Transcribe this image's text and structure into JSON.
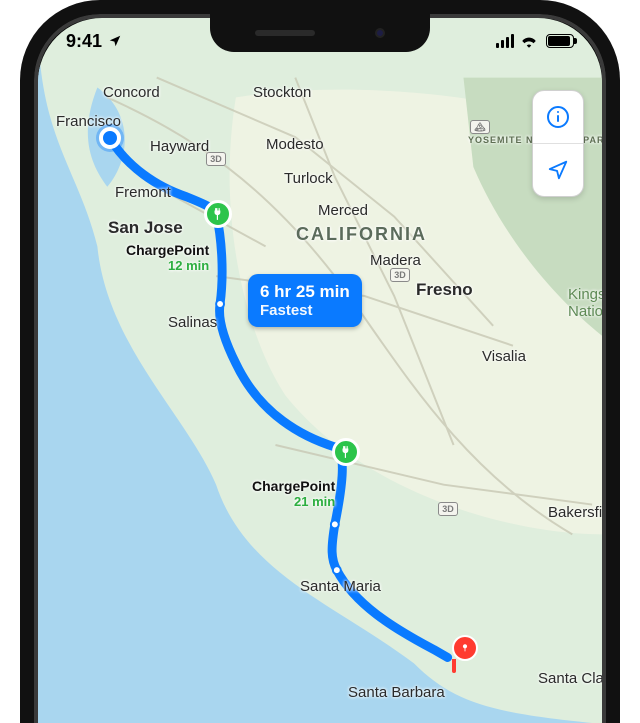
{
  "status_bar": {
    "time": "9:41"
  },
  "region_label": "CALIFORNIA",
  "park_label": "YOSEMITE NATIONAL PARK",
  "cities": {
    "concord": {
      "text": "Concord",
      "t": 66,
      "l": 65,
      "cls": "town"
    },
    "stockton": {
      "text": "Stockton",
      "t": 66,
      "l": 215,
      "cls": "town"
    },
    "sf": {
      "text": "Francisco",
      "t": 95,
      "l": 18,
      "cls": "town"
    },
    "hayward": {
      "text": "Hayward",
      "t": 120,
      "l": 112,
      "cls": "town"
    },
    "modesto": {
      "text": "Modesto",
      "t": 118,
      "l": 228,
      "cls": "town"
    },
    "turlock": {
      "text": "Turlock",
      "t": 152,
      "l": 246,
      "cls": "town"
    },
    "fremont": {
      "text": "Fremont",
      "t": 166,
      "l": 77,
      "cls": "town"
    },
    "merced": {
      "text": "Merced",
      "t": 184,
      "l": 280,
      "cls": "town"
    },
    "sanjose": {
      "text": "San Jose",
      "t": 200,
      "l": 70,
      "cls": "city"
    },
    "madera": {
      "text": "Madera",
      "t": 234,
      "l": 332,
      "cls": "town"
    },
    "fresno": {
      "text": "Fresno",
      "t": 262,
      "l": 378,
      "cls": "city"
    },
    "kings": {
      "text": "Kings\nNation",
      "t": 268,
      "l": 530,
      "cls": "town"
    },
    "salinas": {
      "text": "Salinas",
      "t": 296,
      "l": 130,
      "cls": "town"
    },
    "visalia": {
      "text": "Visalia",
      "t": 330,
      "l": 444,
      "cls": "town"
    },
    "bakersfield": {
      "text": "Bakersfield",
      "t": 486,
      "l": 510,
      "cls": "town"
    },
    "santamaria": {
      "text": "Santa Maria",
      "t": 560,
      "l": 262,
      "cls": "town"
    },
    "santabarbara": {
      "text": "Santa Barbara",
      "t": 666,
      "l": 310,
      "cls": "town"
    },
    "santaclarita": {
      "text": "Santa Clarita",
      "t": 652,
      "l": 500,
      "cls": "town"
    }
  },
  "route": {
    "callout": {
      "title": "6 hr 25 min",
      "subtitle": "Fastest"
    }
  },
  "charging_stops": [
    {
      "id": "stop-1",
      "name": "ChargePoint",
      "duration": "12 min",
      "pin": {
        "t": 196,
        "l": 180
      },
      "label": {
        "t": 224,
        "l": 88
      }
    },
    {
      "id": "stop-2",
      "name": "ChargePoint",
      "duration": "21 min",
      "pin": {
        "t": 434,
        "l": 308
      },
      "label": {
        "t": 460,
        "l": 214
      }
    }
  ],
  "origin": {
    "t": 120,
    "l": 72
  },
  "destination": {
    "t": 640,
    "l": 414
  },
  "colors": {
    "accent": "#0a7aff",
    "charge": "#2cc44b",
    "dest": "#ff3b30"
  }
}
